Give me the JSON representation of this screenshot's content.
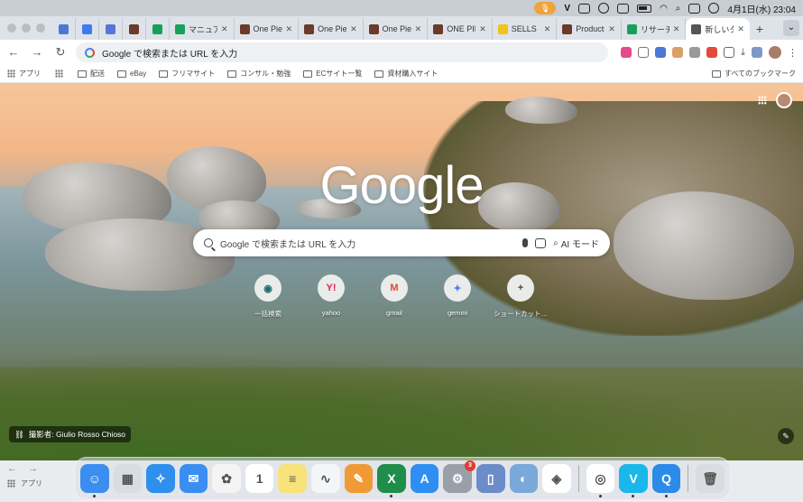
{
  "menubar": {
    "date_time": "4月1日(水) 23:04"
  },
  "tabs": [
    {
      "title": "",
      "fav_color": "#4a78d6",
      "small": true
    },
    {
      "title": "",
      "fav_color": "#3e7bf2",
      "small": true
    },
    {
      "title": "",
      "fav_color": "#5876d8",
      "small": true
    },
    {
      "title": "",
      "fav_color": "#6a3a2a",
      "small": true
    },
    {
      "title": "",
      "fav_color": "#18a05a",
      "small": true
    },
    {
      "title": "マニュアル",
      "fav_color": "#18a05a"
    },
    {
      "title": "One Piece",
      "fav_color": "#6a3a2a"
    },
    {
      "title": "One Piece",
      "fav_color": "#6a3a2a"
    },
    {
      "title": "One Piece",
      "fav_color": "#6a3a2a"
    },
    {
      "title": "ONE PIECE",
      "fav_color": "#6a3a2a"
    },
    {
      "title": "SELLS",
      "fav_color": "#f0c419"
    },
    {
      "title": "Products",
      "fav_color": "#6a3a2a"
    },
    {
      "title": "リサーチ",
      "fav_color": "#18a05a"
    },
    {
      "title": "新しいタブ",
      "fav_color": "#555",
      "active": true
    }
  ],
  "toolbar": {
    "omnibox_placeholder": "Google で検索または URL を入力"
  },
  "bookmarks": {
    "apps": "アプリ",
    "items": [
      "配送",
      "eBay",
      "フリマサイト",
      "コンサル・勉強",
      "ECサイト一覧",
      "資材購入サイト"
    ],
    "all": "すべてのブックマーク"
  },
  "ntp": {
    "logo": "Google",
    "search_placeholder": "Google で検索または URL を入力",
    "ai_mode": "AI モード",
    "shortcuts": [
      {
        "label": "一括検索",
        "icon": "◉",
        "color": "#1b6e6a"
      },
      {
        "label": "yahoo",
        "icon": "Y!",
        "color": "#e0245e"
      },
      {
        "label": "gmail",
        "icon": "M",
        "color": "#ea4335"
      },
      {
        "label": "gemini",
        "icon": "✦",
        "color": "#4c7cf0"
      },
      {
        "label": "ショートカット…",
        "icon": "+",
        "color": "#444"
      }
    ],
    "credit": "撮影者: Giulio Rosso Chioso"
  },
  "bg_window": {
    "apps_label": "アプリ"
  },
  "dock": [
    {
      "name": "finder",
      "color": "#3b8ef0",
      "glyph": "☺",
      "running": true
    },
    {
      "name": "launchpad",
      "color": "#d8dde4",
      "glyph": "▦"
    },
    {
      "name": "safari",
      "color": "#2f8fef",
      "glyph": "✧"
    },
    {
      "name": "mail",
      "color": "#3a8ef2",
      "glyph": "✉"
    },
    {
      "name": "photos",
      "color": "#f4f4f4",
      "glyph": "✿"
    },
    {
      "name": "calendar",
      "color": "#ffffff",
      "glyph": "1"
    },
    {
      "name": "notes",
      "color": "#f8e27a",
      "glyph": "≡"
    },
    {
      "name": "freeform",
      "color": "#f3f5f7",
      "glyph": "∿"
    },
    {
      "name": "pages",
      "color": "#f09a35",
      "glyph": "✎"
    },
    {
      "name": "excel",
      "color": "#1f8d4c",
      "glyph": "X",
      "running": true
    },
    {
      "name": "app-store",
      "color": "#2e8ef2",
      "glyph": "A"
    },
    {
      "name": "system-settings",
      "color": "#9aa0a8",
      "glyph": "⚙",
      "badge": "3"
    },
    {
      "name": "simulator",
      "color": "#6b8cc8",
      "glyph": "▯"
    },
    {
      "name": "preview",
      "color": "#7aa8d8",
      "glyph": "◐"
    },
    {
      "name": "canva",
      "color": "#ffffff",
      "glyph": "◈"
    },
    {
      "name": "chrome",
      "color": "#ffffff",
      "glyph": "◎",
      "running": true
    },
    {
      "name": "vimeo",
      "color": "#1ab7ea",
      "glyph": "V",
      "running": true
    },
    {
      "name": "quickq",
      "color": "#2b8be8",
      "glyph": "Q",
      "running": true
    },
    {
      "name": "trash",
      "color": "#d9dde2",
      "glyph": "🗑"
    }
  ]
}
